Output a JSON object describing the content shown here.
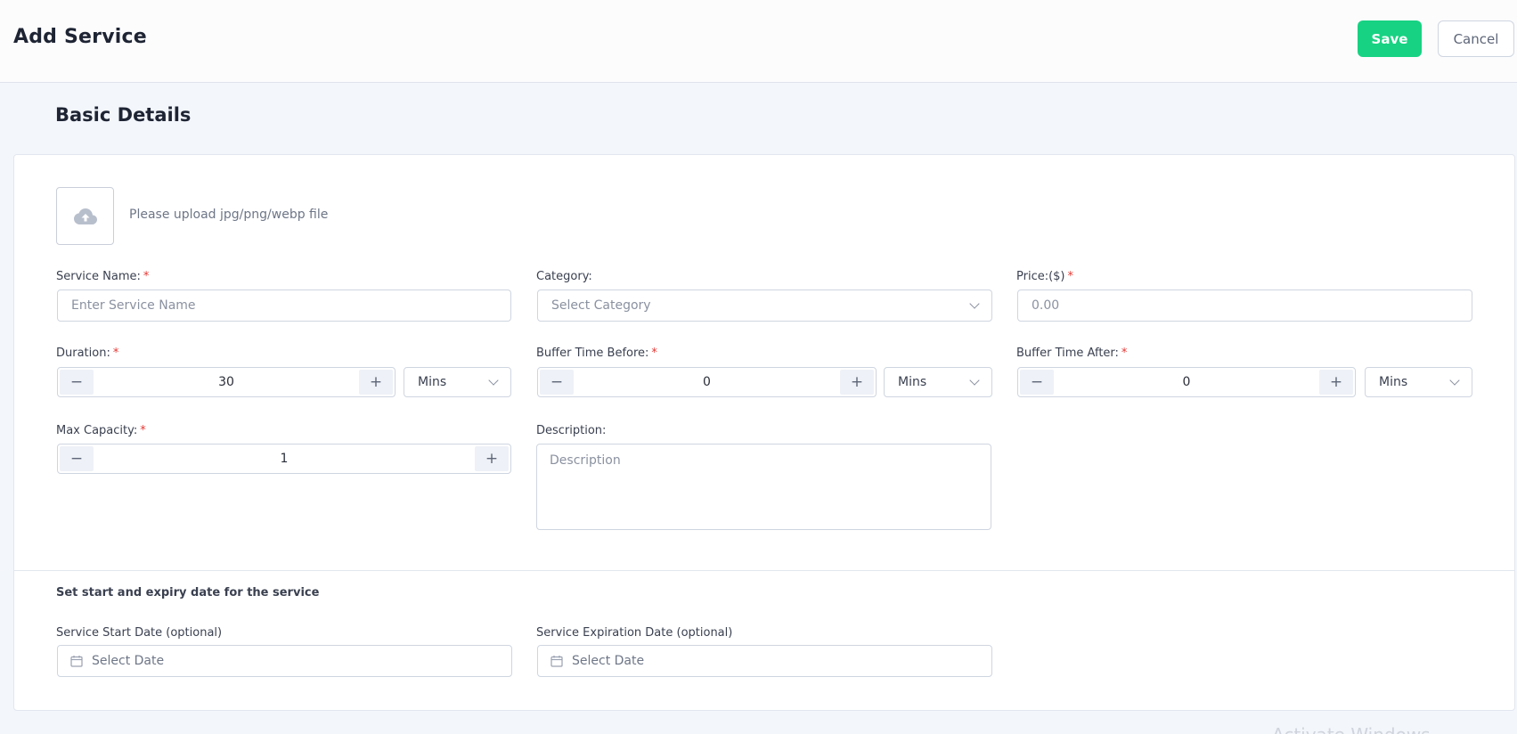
{
  "header": {
    "title": "Add Service",
    "save_label": "Save",
    "cancel_label": "Cancel"
  },
  "section_title": "Basic Details",
  "upload": {
    "hint": "Please upload jpg/png/webp file",
    "icon": "cloud-upload-icon"
  },
  "fields": {
    "service_name": {
      "label": "Service Name:",
      "required": "*",
      "placeholder": "Enter Service Name",
      "value": ""
    },
    "category": {
      "label": "Category:",
      "placeholder": "Select Category"
    },
    "price": {
      "label": "Price:($)",
      "required": "*",
      "placeholder": "0.00"
    },
    "duration": {
      "label": "Duration:",
      "required": "*",
      "value": "30",
      "unit": "Mins"
    },
    "buffer_before": {
      "label": "Buffer Time Before:",
      "required": "*",
      "value": "0",
      "unit": "Mins"
    },
    "buffer_after": {
      "label": "Buffer Time After:",
      "required": "*",
      "value": "0",
      "unit": "Mins"
    },
    "max_capacity": {
      "label": "Max Capacity:",
      "required": "*",
      "value": "1"
    },
    "description": {
      "label": "Description:",
      "placeholder": "Description"
    }
  },
  "stepper": {
    "minus": "−",
    "plus": "+"
  },
  "dates": {
    "heading": "Set start and expiry date for the service",
    "start": {
      "label": "Service Start Date (optional)",
      "placeholder": "Select Date"
    },
    "expiry": {
      "label": "Service Expiration Date (optional)",
      "placeholder": "Select Date"
    }
  },
  "watermark": "Activate Windows",
  "colors": {
    "primary": "#17d282",
    "required": "#e53935",
    "background": "#f3f6fb"
  }
}
